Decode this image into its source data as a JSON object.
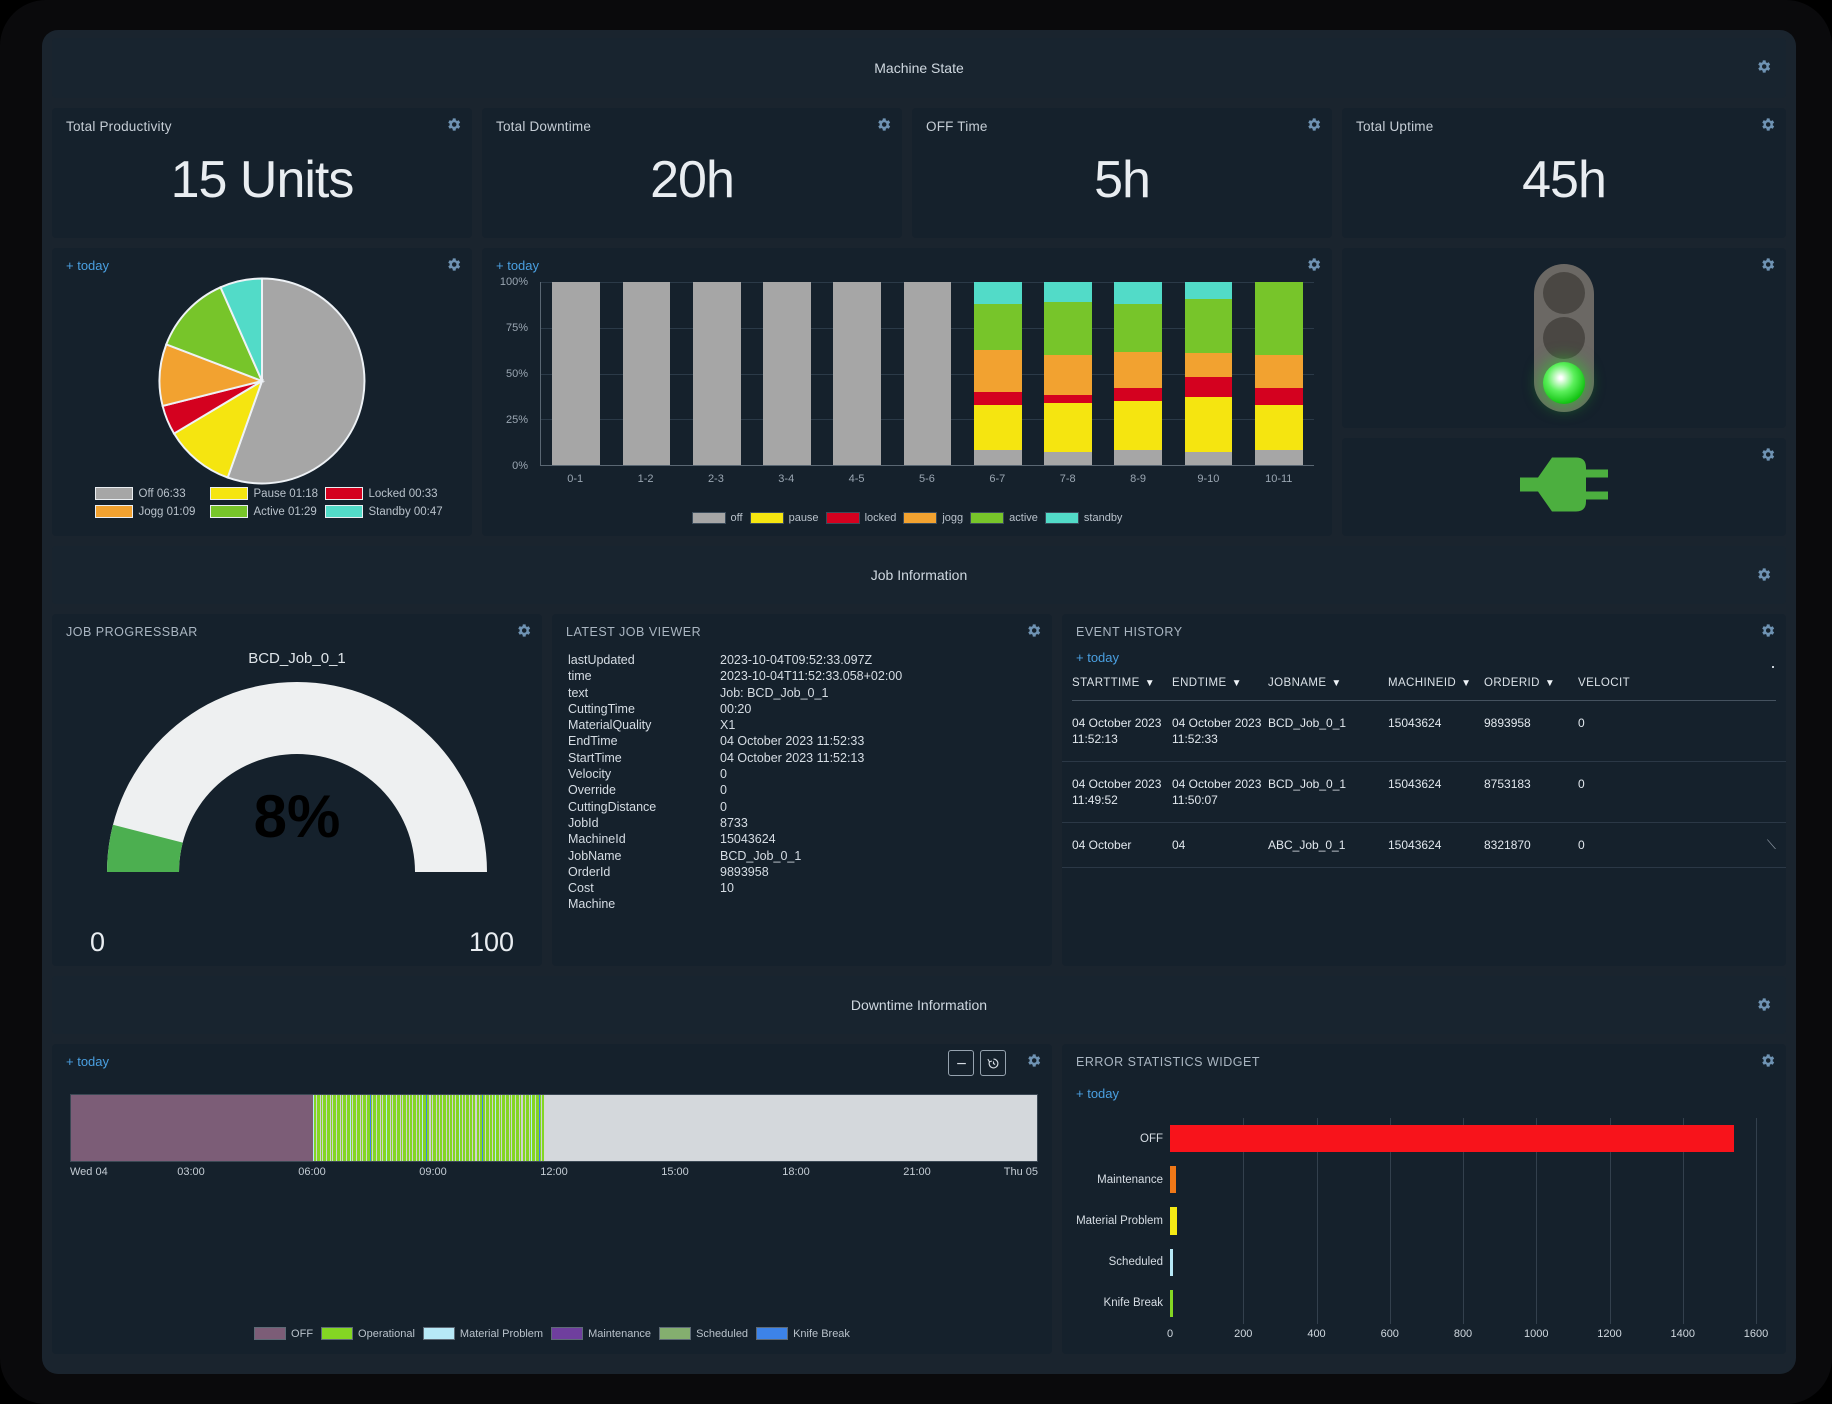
{
  "sections": {
    "machine_state": "Machine State",
    "job_information": "Job Information",
    "downtime_information": "Downtime Information"
  },
  "kpis": [
    {
      "label": "Total Productivity",
      "value": "15 Units"
    },
    {
      "label": "Total Downtime",
      "value": "20h"
    },
    {
      "label": "OFF Time",
      "value": "5h"
    },
    {
      "label": "Total Uptime",
      "value": "45h"
    }
  ],
  "today_link": "+ today",
  "pie_panel": {
    "legend": [
      {
        "label": "Off 06:33",
        "color": "#a6a6a6"
      },
      {
        "label": "Pause 01:18",
        "color": "#f5e510"
      },
      {
        "label": "Locked 00:33",
        "color": "#d4011f"
      },
      {
        "label": "Jogg 01:09",
        "color": "#f2a230"
      },
      {
        "label": "Active 01:29",
        "color": "#77c52a"
      },
      {
        "label": "Standby 00:47",
        "color": "#52dbc8"
      }
    ]
  },
  "traffic_light": {
    "state": "green",
    "lamps": [
      "red-off",
      "yellow-off",
      "green-on"
    ]
  },
  "power_plug": {
    "state": "connected",
    "color": "#4caf3f"
  },
  "gauge": {
    "job_name": "BCD_Job_0_1",
    "percent_label": "8%",
    "percent": 8,
    "min": "0",
    "max": "100",
    "fill_color": "#4caf50",
    "track_color": "#eef0f1"
  },
  "job_viewer": {
    "title": "LATEST JOB VIEWER",
    "rows": [
      {
        "key": "lastUpdated",
        "value": "2023-10-04T09:52:33.097Z"
      },
      {
        "key": "time",
        "value": "2023-10-04T11:52:33.058+02:00"
      },
      {
        "key": "text",
        "value": "Job: BCD_Job_0_1"
      },
      {
        "key": "CuttingTime",
        "value": "00:20"
      },
      {
        "key": "MaterialQuality",
        "value": "X1"
      },
      {
        "key": "EndTime",
        "value": "04 October 2023 11:52:33"
      },
      {
        "key": "StartTime",
        "value": "04 October 2023 11:52:13"
      },
      {
        "key": "Velocity",
        "value": "0"
      },
      {
        "key": "Override",
        "value": "0"
      },
      {
        "key": "CuttingDistance",
        "value": "0"
      },
      {
        "key": "JobId",
        "value": "8733"
      },
      {
        "key": "MachineId",
        "value": "15043624"
      },
      {
        "key": "JobName",
        "value": "BCD_Job_0_1"
      },
      {
        "key": "OrderId",
        "value": "9893958"
      },
      {
        "key": "Cost",
        "value": "10"
      },
      {
        "key": "Machine",
        "value": ""
      }
    ]
  },
  "job_progressbar": {
    "title": "JOB PROGRESSBAR"
  },
  "event_history": {
    "title": "EVENT HISTORY",
    "columns": [
      "STARTTIME",
      "ENDTIME",
      "JOBNAME",
      "MACHINEID",
      "ORDERID",
      "VELOCIT"
    ],
    "rows": [
      {
        "starttime": "04 October 2023 11:52:13",
        "endtime": "04 October 2023 11:52:33",
        "jobname": "BCD_Job_0_1",
        "machineid": "15043624",
        "orderid": "9893958",
        "velocity": "0"
      },
      {
        "starttime": "04 October 2023 11:49:52",
        "endtime": "04 October 2023 11:50:07",
        "jobname": "BCD_Job_0_1",
        "machineid": "15043624",
        "orderid": "8753183",
        "velocity": "0"
      },
      {
        "starttime": "04 October",
        "endtime": "04",
        "jobname": "ABC_Job_0_1",
        "machineid": "15043624",
        "orderid": "8321870",
        "velocity": "0"
      }
    ]
  },
  "error_stats": {
    "title": "ERROR STATISTICS WIDGET"
  },
  "downtime_timeline": {
    "axis_ticks": [
      "Wed 04",
      "03:00",
      "06:00",
      "09:00",
      "12:00",
      "15:00",
      "18:00",
      "21:00",
      "Thu 05"
    ],
    "legend": [
      {
        "label": "OFF",
        "color": "#7c5d77"
      },
      {
        "label": "Operational",
        "color": "#84d623"
      },
      {
        "label": "Material Problem",
        "color": "#b7e9f7"
      },
      {
        "label": "Maintenance",
        "color": "#6f3f9e"
      },
      {
        "label": "Scheduled",
        "color": "#84ae6f"
      },
      {
        "label": "Knife Break",
        "color": "#3d83e8"
      }
    ]
  },
  "chart_data": [
    {
      "type": "pie",
      "title": "",
      "categories": [
        "Off",
        "Pause",
        "Locked",
        "Jogg",
        "Active",
        "Standby"
      ],
      "labels": [
        "Off 06:33",
        "Pause 01:18",
        "Locked 00:33",
        "Jogg 01:09",
        "Active 01:29",
        "Standby 00:47"
      ],
      "values": [
        393,
        78,
        33,
        69,
        89,
        47
      ],
      "unit": "minutes",
      "colors": [
        "#a6a6a6",
        "#f5e510",
        "#d4011f",
        "#f2a230",
        "#77c52a",
        "#52dbc8"
      ],
      "legend_position": "bottom"
    },
    {
      "type": "bar",
      "subtype": "stacked-percent",
      "title": "",
      "xlabel": "",
      "ylabel": "",
      "ylim": [
        0,
        100
      ],
      "ytick_labels": [
        "0%",
        "25%",
        "50%",
        "75%",
        "100%"
      ],
      "yticks": [
        0,
        25,
        50,
        75,
        100
      ],
      "grid": true,
      "legend_position": "bottom",
      "categories": [
        "0-1",
        "1-2",
        "2-3",
        "3-4",
        "4-5",
        "5-6",
        "6-7",
        "7-8",
        "8-9",
        "9-10",
        "10-11"
      ],
      "series": [
        {
          "name": "off",
          "color": "#a6a6a6",
          "values": [
            100,
            100,
            100,
            100,
            100,
            100,
            8,
            7,
            8,
            7,
            8
          ]
        },
        {
          "name": "pause",
          "color": "#f5e510",
          "values": [
            0,
            0,
            0,
            0,
            0,
            0,
            25,
            27,
            27,
            30,
            25
          ]
        },
        {
          "name": "locked",
          "color": "#d4011f",
          "values": [
            0,
            0,
            0,
            0,
            0,
            0,
            7,
            4,
            7,
            11,
            9
          ]
        },
        {
          "name": "jogg",
          "color": "#f2a230",
          "values": [
            0,
            0,
            0,
            0,
            0,
            0,
            23,
            22,
            20,
            13,
            18
          ]
        },
        {
          "name": "active",
          "color": "#77c52a",
          "values": [
            0,
            0,
            0,
            0,
            0,
            0,
            25,
            29,
            26,
            30,
            40
          ]
        },
        {
          "name": "standby",
          "color": "#52dbc8",
          "values": [
            0,
            0,
            0,
            0,
            0,
            0,
            12,
            11,
            12,
            9,
            0
          ]
        }
      ]
    },
    {
      "type": "bar",
      "subtype": "horizontal",
      "title": "ERROR STATISTICS WIDGET",
      "xlabel": "",
      "ylabel": "",
      "xlim": [
        0,
        1600
      ],
      "xtick_labels": [
        "0",
        "200",
        "400",
        "600",
        "800",
        "1000",
        "1200",
        "1400",
        "1600"
      ],
      "xticks": [
        0,
        200,
        400,
        600,
        800,
        1000,
        1200,
        1400,
        1600
      ],
      "grid": true,
      "categories": [
        "OFF",
        "Maintenance",
        "Material Problem",
        "Scheduled",
        "Knife Break"
      ],
      "values": [
        1540,
        16,
        18,
        8,
        8
      ],
      "colors": [
        "#f8131b",
        "#f07818",
        "#f5ea15",
        "#b7e9f7",
        "#84d623"
      ]
    },
    {
      "type": "area",
      "subtype": "timeline",
      "title": "",
      "xlabel": "",
      "ylabel": "",
      "xtick_labels": [
        "Wed 04",
        "03:00",
        "06:00",
        "09:00",
        "12:00",
        "15:00",
        "18:00",
        "21:00",
        "Thu 05"
      ],
      "segments": [
        {
          "label": "OFF",
          "color": "#7c5d77",
          "start": "00:00",
          "end": "06:00",
          "pct": 25
        },
        {
          "label": "Operational",
          "color": "#84d623",
          "start": "06:00",
          "end": "11:50",
          "pct": 24
        },
        {
          "label": "Scheduled",
          "color": "#d4d8dc",
          "start": "11:50",
          "end": "24:00",
          "pct": 51
        }
      ]
    }
  ]
}
